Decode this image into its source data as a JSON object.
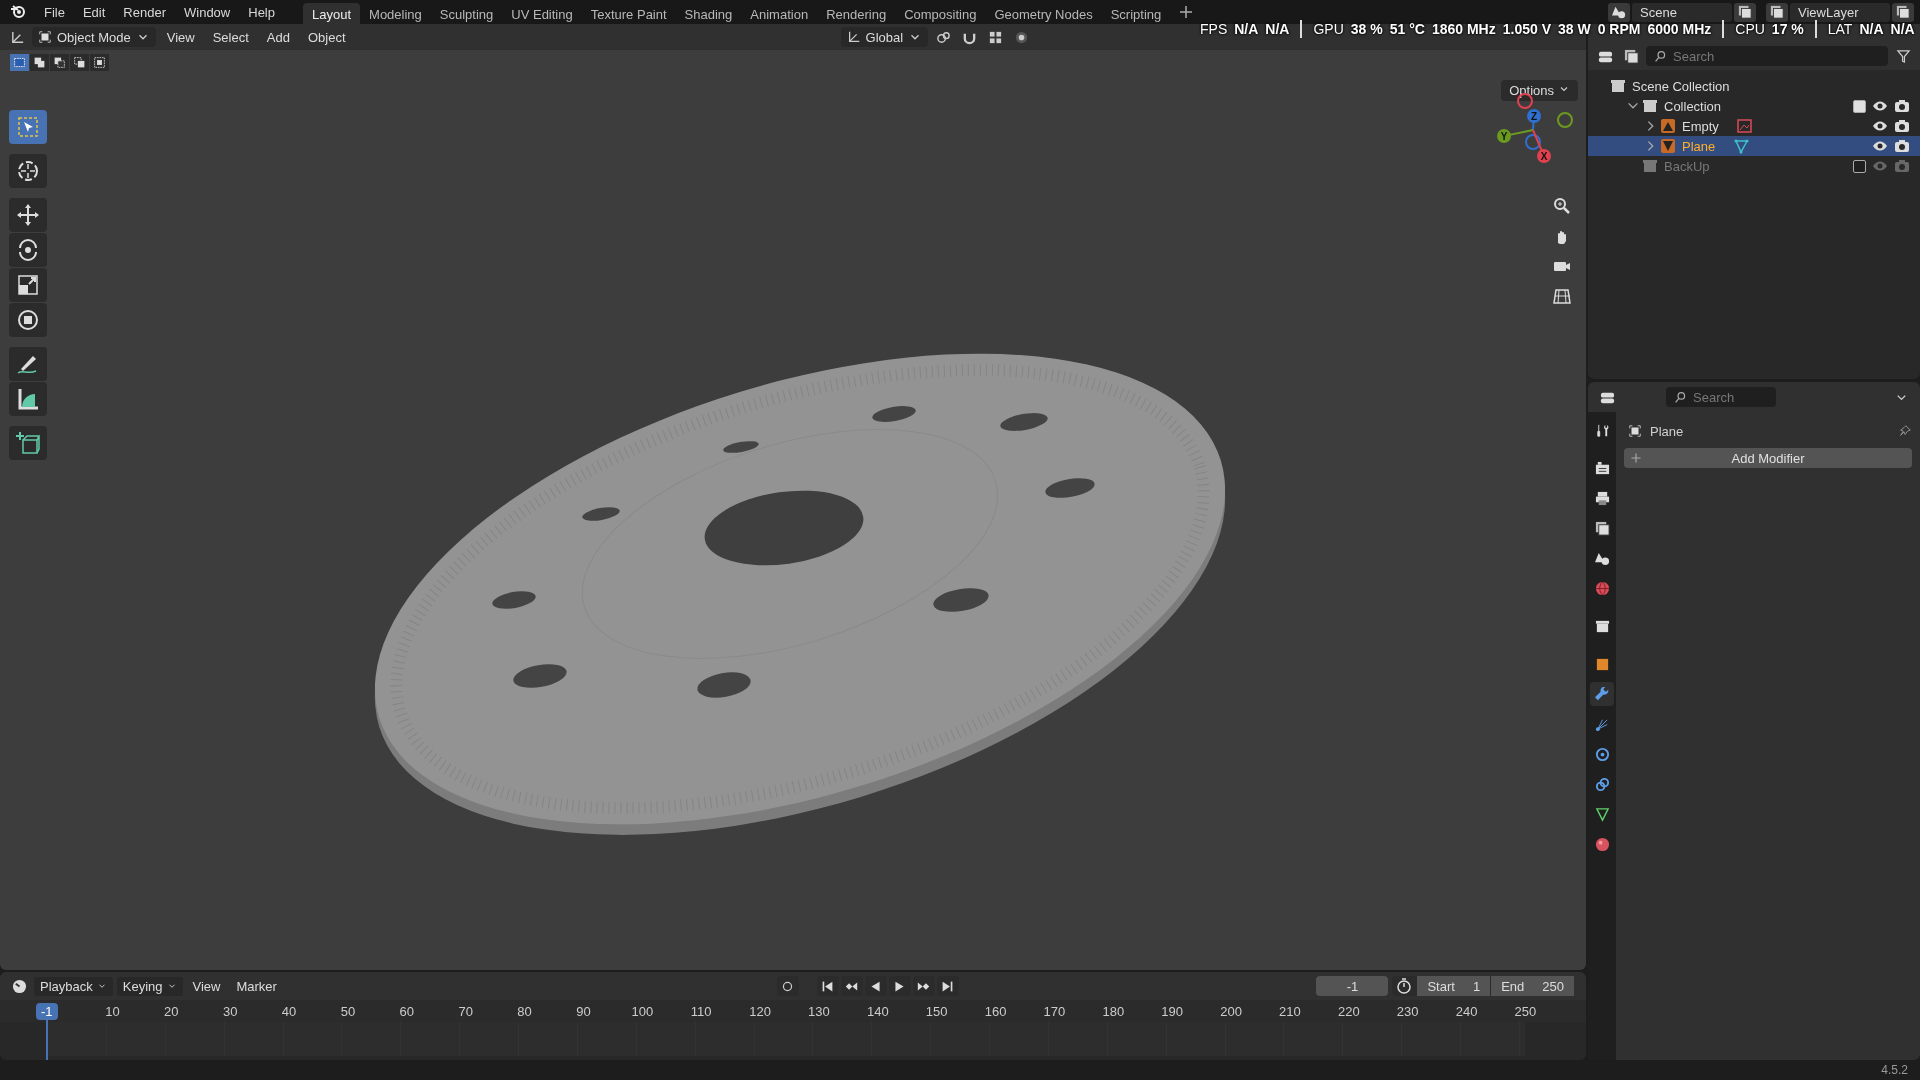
{
  "top_bar": {
    "menus": [
      "File",
      "Edit",
      "Render",
      "Window",
      "Help"
    ],
    "workspaces": [
      {
        "label": "Layout",
        "selected": true
      },
      {
        "label": "Modeling",
        "selected": false
      },
      {
        "label": "Sculpting",
        "selected": false
      },
      {
        "label": "UV Editing",
        "selected": false
      },
      {
        "label": "Texture Paint",
        "selected": false
      },
      {
        "label": "Shading",
        "selected": false
      },
      {
        "label": "Animation",
        "selected": false
      },
      {
        "label": "Rendering",
        "selected": false
      },
      {
        "label": "Compositing",
        "selected": false
      },
      {
        "label": "Geometry Nodes",
        "selected": false
      },
      {
        "label": "Scripting",
        "selected": false
      }
    ],
    "scene": "Scene",
    "view_layer": "ViewLayer"
  },
  "monitor_overlay": [
    {
      "label": "FPS",
      "values": [
        "N/A",
        "N/A"
      ]
    },
    {
      "label": "GPU",
      "values": [
        "38 %",
        "51 °C",
        "1860 MHz",
        "1.050 V",
        "38 W",
        "0 RPM",
        "6000 MHz"
      ]
    },
    {
      "label": "CPU",
      "values": [
        "17 %"
      ]
    },
    {
      "label": "LAT",
      "values": [
        "N/A",
        "N/A"
      ]
    }
  ],
  "viewport": {
    "mode": "Object Mode",
    "menus": [
      "View",
      "Select",
      "Add",
      "Object"
    ],
    "orientation": "Global",
    "options": "Options",
    "select_modes": [
      {
        "selected": true
      },
      {
        "selected": false
      },
      {
        "selected": false
      },
      {
        "selected": false
      },
      {
        "selected": false
      }
    ],
    "tools": [
      {
        "kind": "select",
        "selected": true
      },
      {
        "kind": "cursor",
        "selected": false
      },
      {
        "kind": "move",
        "selected": false
      },
      {
        "kind": "rotate",
        "selected": false
      },
      {
        "kind": "scale",
        "selected": false
      },
      {
        "kind": "transform",
        "selected": false
      },
      {
        "kind": "annotate",
        "selected": false
      },
      {
        "kind": "measure",
        "selected": false
      },
      {
        "kind": "add_cube",
        "selected": false
      }
    ],
    "gizmo_axes": [
      {
        "label": "Z",
        "color": "#2f6fd0"
      },
      {
        "label": "Y",
        "color": "#6a9a1f"
      },
      {
        "label": "X",
        "color": "#e0414f"
      }
    ]
  },
  "outliner": {
    "search_placeholder": "Search",
    "tree": [
      {
        "label": "Scene Collection",
        "kind": "scene",
        "selected": false,
        "children": [
          {
            "label": "Collection",
            "kind": "collection",
            "selected": false,
            "expanded": true,
            "checked": true,
            "disabled": false,
            "children": [
              {
                "label": "Empty",
                "kind": "empty",
                "selected": false,
                "expanded": false
              },
              {
                "label": "Plane",
                "kind": "mesh",
                "selected": true,
                "expanded": false
              }
            ]
          },
          {
            "label": "BackUp",
            "kind": "collection",
            "selected": false,
            "checked": false,
            "disabled": true
          }
        ]
      }
    ]
  },
  "properties": {
    "search_placeholder": "Search",
    "tabs": [
      {
        "kind": "tool",
        "selected": false
      },
      {
        "kind": "render",
        "selected": false
      },
      {
        "kind": "output",
        "selected": false
      },
      {
        "kind": "view_layer",
        "selected": false
      },
      {
        "kind": "scene",
        "selected": false
      },
      {
        "kind": "world",
        "selected": false
      },
      {
        "kind": "collection",
        "selected": false
      },
      {
        "kind": "object",
        "selected": false
      },
      {
        "kind": "modifiers",
        "selected": true
      },
      {
        "kind": "particles",
        "selected": false
      },
      {
        "kind": "physics",
        "selected": false
      },
      {
        "kind": "constraints",
        "selected": false
      },
      {
        "kind": "data",
        "selected": false
      },
      {
        "kind": "material",
        "selected": false
      }
    ],
    "object_name": "Plane",
    "add_modifier": "Add Modifier"
  },
  "timeline": {
    "menus": [
      {
        "label": "Playback",
        "kind": "dropdown"
      },
      {
        "label": "Keying",
        "kind": "dropdown"
      },
      {
        "label": "View",
        "kind": "menu"
      },
      {
        "label": "Marker",
        "kind": "menu"
      }
    ],
    "current_frame": "-1",
    "start_label": "Start",
    "start": "1",
    "end_label": "End",
    "end": "250",
    "playhead": "-1",
    "ruler": [
      "10",
      "20",
      "30",
      "40",
      "50",
      "60",
      "70",
      "80",
      "90",
      "100",
      "110",
      "120",
      "130",
      "140",
      "150",
      "160",
      "170",
      "180",
      "190",
      "200",
      "210",
      "220",
      "230",
      "240",
      "250"
    ]
  },
  "status_bar": {
    "version": "4.5.2"
  }
}
